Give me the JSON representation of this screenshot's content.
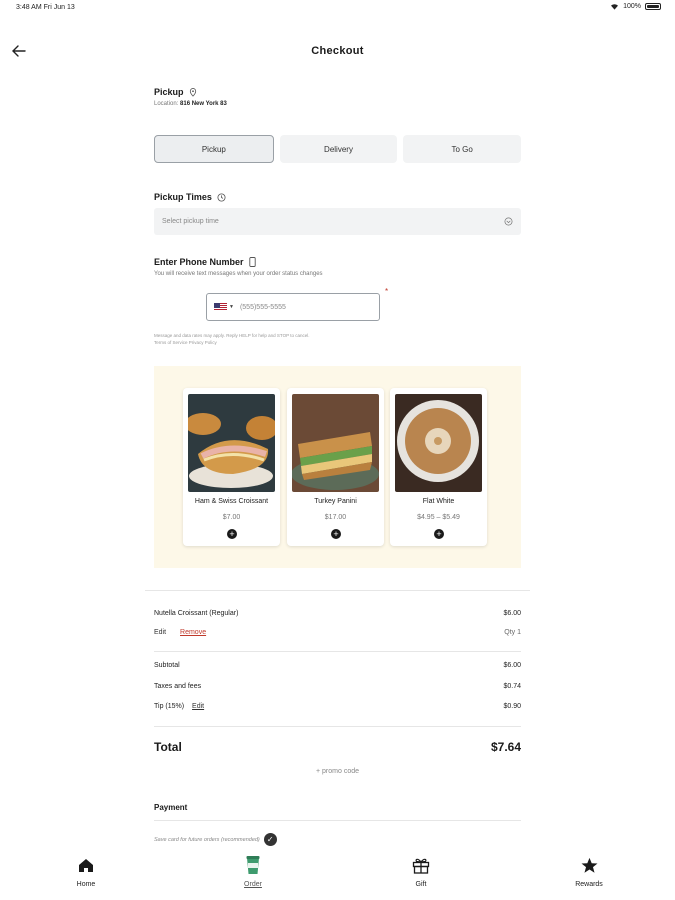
{
  "status_bar": {
    "time": "3:48 AM  Fri Jun 13",
    "battery": "100%"
  },
  "header": {
    "title": "Checkout"
  },
  "pickup": {
    "label": "Pickup",
    "location_prefix": "Location:",
    "location": "816 New York 83"
  },
  "order_type": {
    "options": [
      "Pickup",
      "Delivery",
      "To Go"
    ],
    "selected": "Pickup"
  },
  "pickup_times": {
    "label": "Pickup Times",
    "placeholder": "Select pickup time"
  },
  "phone": {
    "label": "Enter Phone Number",
    "helper": "You will receive text messages when your order status changes",
    "placeholder": "(555)555-5555",
    "required_mark": "*",
    "disclaimer_line1": "Message and data rates may apply. Reply HELP for help and STOP to cancel.",
    "disclaimer_line2": "Terms of Service Privacy Policy"
  },
  "upsell": {
    "items": [
      {
        "name": "Ham & Swiss Croissant",
        "price": "$7.00"
      },
      {
        "name": "Turkey Panini",
        "price": "$17.00"
      },
      {
        "name": "Flat White",
        "price": "$4.95 – $5.49"
      }
    ],
    "add_symbol": "+"
  },
  "cart": {
    "item_name": "Nutella Croissant (Regular)",
    "item_price": "$6.00",
    "edit_label": "Edit",
    "remove_label": "Remove",
    "qty_label": "Qty 1"
  },
  "summary": {
    "subtotal_label": "Subtotal",
    "subtotal": "$6.00",
    "taxes_label": "Taxes and fees",
    "taxes": "$0.74",
    "tip_label": "Tip (15%)",
    "tip_edit": "Edit",
    "tip": "$0.90",
    "total_label": "Total",
    "total": "$7.64",
    "promo": "+ promo code"
  },
  "payment": {
    "label": "Payment",
    "save_card": "Save card for future orders (recommended)"
  },
  "tabbar": {
    "tabs": [
      "Home",
      "Order",
      "Gift",
      "Rewards"
    ],
    "active": "Order"
  },
  "colors": {
    "accent_red": "#c0392b",
    "upsell_bg": "#fdf8e8",
    "order_tab": "#3e9b6e"
  }
}
